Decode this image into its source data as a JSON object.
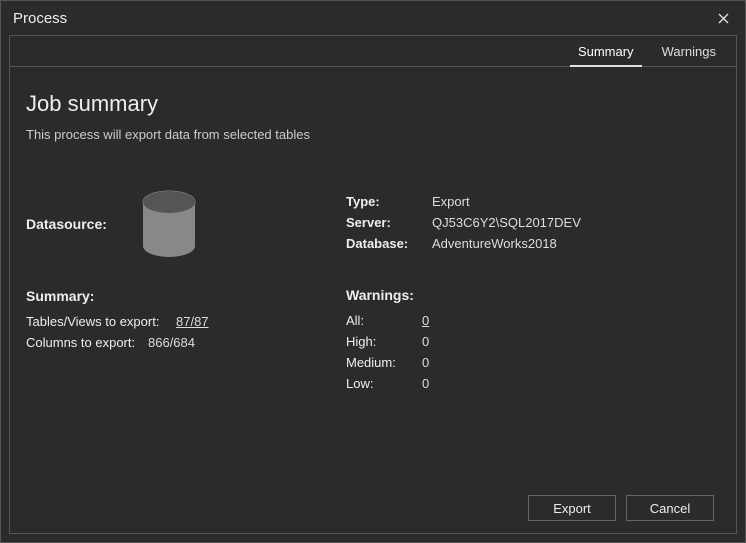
{
  "window": {
    "title": "Process"
  },
  "tabs": {
    "summary": "Summary",
    "warnings": "Warnings"
  },
  "job": {
    "heading": "Job summary",
    "description": "This process will export data from selected tables"
  },
  "datasource": {
    "label": "Datasource:",
    "type_label": "Type:",
    "type_value": "Export",
    "server_label": "Server:",
    "server_value": "QJ53C6Y2\\SQL2017DEV",
    "database_label": "Database:",
    "database_value": "AdventureWorks2018"
  },
  "summary": {
    "label": "Summary:",
    "tables_label": "Tables/Views to export:",
    "tables_value": "87/87",
    "columns_label": "Columns to export:",
    "columns_value": "866/684"
  },
  "warnings": {
    "label": "Warnings:",
    "all_label": "All:",
    "all_value": "0",
    "high_label": "High:",
    "high_value": "0",
    "medium_label": "Medium:",
    "medium_value": "0",
    "low_label": "Low:",
    "low_value": "0"
  },
  "buttons": {
    "export": "Export",
    "cancel": "Cancel"
  }
}
